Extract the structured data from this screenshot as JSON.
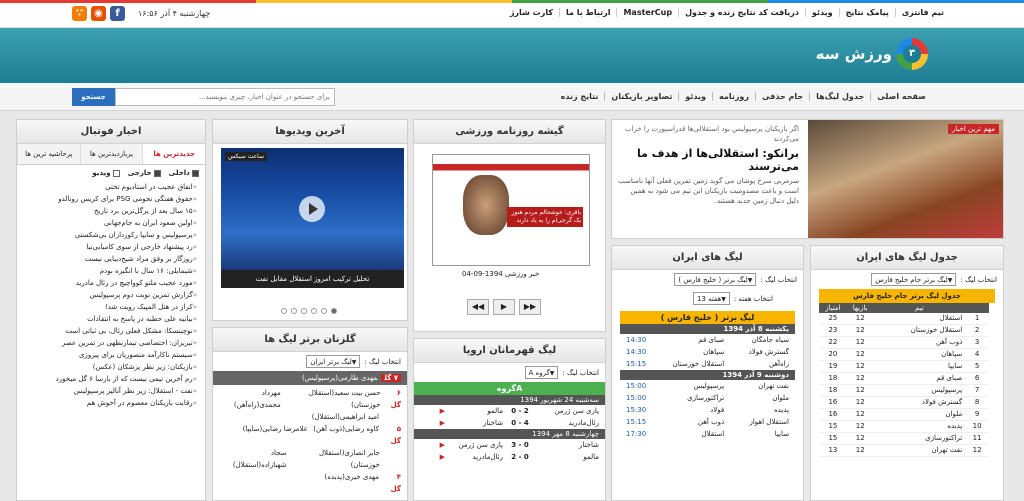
{
  "top_nav": [
    "تیم فانتزی",
    "پیامک نتایج",
    "ویدئو",
    "دریافت کد نتایج زنده و جدول",
    "MasterCup",
    "ارتباط با ما",
    "کارت شارژ"
  ],
  "date_text": "چهارشنبه ۴ آذر   ۱۶:۵۶",
  "logo_text": "ورزش سه",
  "logo_mark": "۳",
  "main_nav": [
    "صفحه اصلی",
    "جدول لیگ‌ها",
    "جام حذفی",
    "روزنامه",
    "ویدئو",
    "تصاویر بازیکنان",
    "نتایج زنده"
  ],
  "search": {
    "placeholder": "برای جستجو در عنوان اخبار، چیزی بنویسید...",
    "button": "جستجو"
  },
  "featured": {
    "badge": "مهم ترین اخبار",
    "pre": "اگر بازیکنان پرسپولیس بود استقلالی‌ها قدراسپورت را خراب می‌کردند",
    "title": "برانکو: استقلالی‌ها از هدف ما می‌ترسند",
    "summary": "سرمربی سرخ پوشان می گوید زمین تمرین فعلی آنها نامناسب است و باعث مصدومیت بازیکنان این تیم می شود به همین دلیل دنبال زمین جدید هستند.",
    "dots": 10,
    "active": 7
  },
  "football_news": {
    "title": "اخبار فوتبال",
    "tabs": [
      "جدیدترین ها",
      "پربازدیدترین ها",
      "پرحاشیه ترین ها"
    ],
    "filters": [
      "داخلی",
      "خارجی",
      "ویدیو"
    ],
    "items": [
      "اتفاق عجیب در استادیوم تختی",
      "حقوق هفتگی نجومی PSG برای کریس رونالدو",
      "۱۵ سال بعد از پرگل‌ترین برد تاریخ",
      "اولین صعود ایران به جام‌جهانی",
      "پرسپولیس و سایپا رکورداران بی‌شکستی",
      "رد پیشنهاد خارجی از سوی کامیابی‌نیا",
      "روزگار بر وفق مراد شیخ‌دیبایی نیست",
      "شیمایلی: ۱۶ سال با انگیزه بودم",
      "مورد عجیب ملتو کوواچیچ در رئال مادرید",
      "گزارش تمرین نوبت دوم پرسپولیس",
      "کراز در هتل المپیک رویت شد!",
      "بیانیه علی حطبه در پاسخ به انتقادات",
      "نوچینسکا: مشکل فعلی رئال، بی ثباتی است",
      "تبریزان: اختصاصی تیمارنظهی در تمرین عصر",
      "سیستم ناکارآمد منصوریان برای پیروزی",
      "بازیکنان: زیر نظر پزشکان (عکس)",
      "رم آخرین تیمی نیست که از بارسا ۶ گل میخورد",
      "نفت - استقلال: زیر نظر آنالیز پرسپولیس",
      "رقابت بازیکنان معصوم در آخوش هم"
    ]
  },
  "videos": {
    "title": "آخرین ویدیوها",
    "badge": "ساعت سیکس",
    "caption": "تحلیل ترکیب امروز استقلال مقابل نفت",
    "dots": 6,
    "active": 6
  },
  "top_scorers": {
    "title": "گلزنان برتر لیگ ها",
    "select_label": "انتخاب لیگ :",
    "select_value": "لیگ برتر ایران",
    "leader_goals": "۷ گل",
    "leader_name": "مهدی طارمی(پرسپولیس)",
    "rows": [
      {
        "g": "۶ گل",
        "a": "حسن بیت سعید(استقلال خوزستان)",
        "b": "مهرداد محمدی(راه‌آهن)"
      },
      {
        "g": "",
        "a": "امید ابراهیمی(استقلال)",
        "b": ""
      },
      {
        "g": "۵ گل",
        "a": "کاوه رضایی(ذوب آهن)",
        "b": "غلامرضا رضایی(سایپا)"
      },
      {
        "g": "",
        "a": "جابر انصاری(استقلال خوزستان)",
        "b": "سجاد شهبازاده(استقلال)"
      },
      {
        "g": "۴ گل",
        "a": "مهدی خیری(پدیده)",
        "b": ""
      }
    ]
  },
  "newspaper": {
    "title": "گیشه روزنامه ورزشی",
    "headline": "باقری: خوشحالم مردم هنوز یک گرجی‌ام را به یاد دارند",
    "date": "خبر ورزشی 1394-09-04"
  },
  "europe": {
    "title": "لیگ قهرمانان اروپا",
    "select_label": "انتخاب لیگ :",
    "select_value": "گروه A",
    "group": "گروهA",
    "days": [
      {
        "d": "سه‌شنبه 24 شهریور 1394",
        "m": [
          {
            "h": "پاری سن ژرمن",
            "s": "2 - 0",
            "a": "مالمو"
          },
          {
            "h": "رئال‌مادرید",
            "s": "4 - 0",
            "a": "شاختار"
          }
        ]
      },
      {
        "d": "چهارشنبه 8 مهر 1394",
        "m": [
          {
            "h": "شاختار",
            "s": "0 - 3",
            "a": "پاری سن ژرمن"
          },
          {
            "h": "مالمو",
            "s": "0 - 2",
            "a": "رئال‌مادرید"
          }
        ]
      }
    ]
  },
  "iran_leagues": {
    "title": "لیگ های ایران",
    "select_label": "انتخاب لیگ :",
    "select_value": "لیگ برتر ( خلیج فارس )",
    "week_label": "انتخاب هفته :",
    "week_value": "هفته 13",
    "league_head": "لیگ برتر ( خلیج فارس )",
    "days": [
      {
        "d": "یکشنبه 8 آذر 1394",
        "m": [
          {
            "h": "سیاه جامگان",
            "a": "صبای قم",
            "t": "14:30"
          },
          {
            "h": "گسترش فولاد",
            "a": "سپاهان",
            "t": "14:30"
          },
          {
            "h": "راه‌آهن",
            "a": "استقلال خوزستان",
            "t": "15:15"
          }
        ]
      },
      {
        "d": "دوشنبه 9 آذر 1394",
        "m": [
          {
            "h": "نفت تهران",
            "a": "پرسپولیس",
            "t": "15:00"
          },
          {
            "h": "ملوان",
            "a": "تراکتورسازی",
            "t": "15:00"
          },
          {
            "h": "پدیده",
            "a": "فولاد",
            "t": "15:30"
          },
          {
            "h": "استقلال اهواز",
            "a": "ذوب آهن",
            "t": "15:15"
          },
          {
            "h": "سایپا",
            "a": "استقلال",
            "t": "17:30"
          }
        ]
      }
    ]
  },
  "standings": {
    "title": "جدول لیگ های ایران",
    "select_label": "انتخاب لیگ :",
    "select_value": "لیگ برتر جام خلیج فارس",
    "table_title": "جدول لیگ برتر جام خلیج فارس",
    "headers": [
      "",
      "تیم",
      "بازیها",
      "امتیاز"
    ],
    "rows": [
      [
        "1",
        "استقلال",
        "12",
        "25"
      ],
      [
        "2",
        "استقلال خوزستان",
        "12",
        "23"
      ],
      [
        "3",
        "ذوب آهن",
        "12",
        "22"
      ],
      [
        "4",
        "سپاهان",
        "12",
        "20"
      ],
      [
        "5",
        "سایپا",
        "12",
        "19"
      ],
      [
        "6",
        "صبای قم",
        "12",
        "18"
      ],
      [
        "7",
        "پرسپولیس",
        "12",
        "18"
      ],
      [
        "8",
        "گسترش فولاد",
        "12",
        "16"
      ],
      [
        "9",
        "ملوان",
        "12",
        "16"
      ],
      [
        "10",
        "پدیده",
        "12",
        "15"
      ],
      [
        "11",
        "تراکتورسازی",
        "12",
        "15"
      ],
      [
        "12",
        "نفت تهران",
        "12",
        "13"
      ]
    ]
  }
}
